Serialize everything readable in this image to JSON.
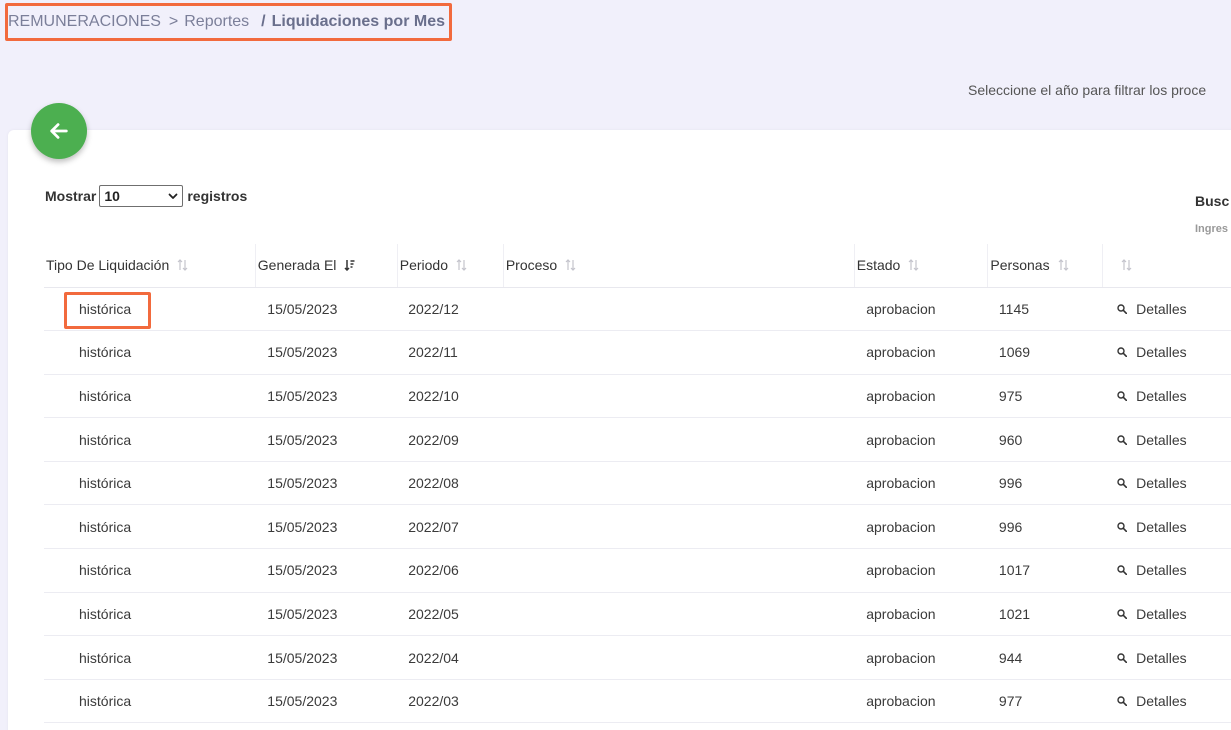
{
  "breadcrumb": {
    "root": "REMUNERACIONES",
    "sep1": ">",
    "middle": "Reportes",
    "sep2": "/",
    "current": "Liquidaciones por Mes"
  },
  "filter_hint": "Seleccione el año para filtrar los proce",
  "back_icon": "arrow-left-icon",
  "length": {
    "prefix": "Mostrar",
    "value": "10",
    "suffix": "registros"
  },
  "search": {
    "label": "Busc",
    "hint": "Ingres"
  },
  "colors": {
    "accent_green": "#4caf50",
    "highlight_orange": "#f26a3d",
    "background": "#f1f0fb"
  },
  "table": {
    "headers": [
      "Tipo De Liquidación",
      "Generada El",
      "Periodo",
      "Proceso",
      "Estado",
      "Personas",
      ""
    ],
    "details_label": "Detalles",
    "rows": [
      {
        "tipo": "histórica",
        "generada": "15/05/2023",
        "periodo": "2022/12",
        "proceso": "",
        "estado": "aprobacion",
        "personas": "1145"
      },
      {
        "tipo": "histórica",
        "generada": "15/05/2023",
        "periodo": "2022/11",
        "proceso": "",
        "estado": "aprobacion",
        "personas": "1069"
      },
      {
        "tipo": "histórica",
        "generada": "15/05/2023",
        "periodo": "2022/10",
        "proceso": "",
        "estado": "aprobacion",
        "personas": "975"
      },
      {
        "tipo": "histórica",
        "generada": "15/05/2023",
        "periodo": "2022/09",
        "proceso": "",
        "estado": "aprobacion",
        "personas": "960"
      },
      {
        "tipo": "histórica",
        "generada": "15/05/2023",
        "periodo": "2022/08",
        "proceso": "",
        "estado": "aprobacion",
        "personas": "996"
      },
      {
        "tipo": "histórica",
        "generada": "15/05/2023",
        "periodo": "2022/07",
        "proceso": "",
        "estado": "aprobacion",
        "personas": "996"
      },
      {
        "tipo": "histórica",
        "generada": "15/05/2023",
        "periodo": "2022/06",
        "proceso": "",
        "estado": "aprobacion",
        "personas": "1017"
      },
      {
        "tipo": "histórica",
        "generada": "15/05/2023",
        "periodo": "2022/05",
        "proceso": "",
        "estado": "aprobacion",
        "personas": "1021"
      },
      {
        "tipo": "histórica",
        "generada": "15/05/2023",
        "periodo": "2022/04",
        "proceso": "",
        "estado": "aprobacion",
        "personas": "944"
      },
      {
        "tipo": "histórica",
        "generada": "15/05/2023",
        "periodo": "2022/03",
        "proceso": "",
        "estado": "aprobacion",
        "personas": "977"
      }
    ]
  }
}
